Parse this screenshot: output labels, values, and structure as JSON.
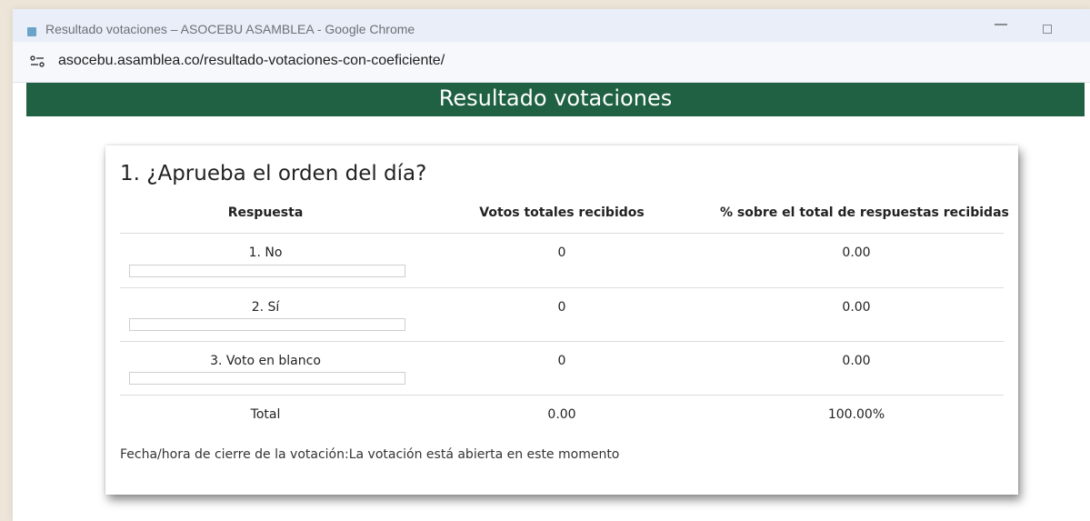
{
  "browser": {
    "window_title": "Resultado votaciones – ASOCEBU ASAMBLEA - Google Chrome",
    "url": "asocebu.asamblea.co/resultado-votaciones-con-coeficiente/",
    "site_icon": "site-settings-icon"
  },
  "page": {
    "title": "Resultado votaciones",
    "accent_color": "#1f6142"
  },
  "poll": {
    "question": "1. ¿Aprueba el orden del día?",
    "headers": {
      "answer": "Respuesta",
      "votes": "Votos totales recibidos",
      "percent": "% sobre el total de respuestas recibidas"
    },
    "rows": [
      {
        "label": "1. No",
        "votes": "0",
        "percent": "0.00",
        "bar_fraction": 0
      },
      {
        "label": "2. Sí",
        "votes": "0",
        "percent": "0.00",
        "bar_fraction": 0
      },
      {
        "label": "3. Voto en blanco",
        "votes": "0",
        "percent": "0.00",
        "bar_fraction": 0
      }
    ],
    "total": {
      "label": "Total",
      "votes": "0.00",
      "percent": "100.00%"
    },
    "closing_label": "Fecha/hora de cierre de la votación:",
    "closing_value": "La votación está abierta en este momento"
  }
}
